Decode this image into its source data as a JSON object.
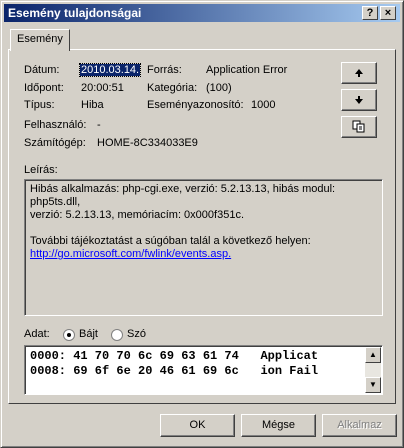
{
  "window": {
    "title": "Esemény tulajdonságai",
    "help_glyph": "?",
    "close_glyph": "×"
  },
  "tab": {
    "label": "Esemény"
  },
  "fields": {
    "date_label": "Dátum:",
    "date_value": "2010.03.14.",
    "time_label": "Időpont:",
    "time_value": "20:00:51",
    "type_label": "Típus:",
    "type_value": "Hiba",
    "user_label": "Felhasználó:",
    "user_value": "-",
    "computer_label": "Számítógép:",
    "computer_value": "HOME-8C334033E9",
    "source_label": "Forrás:",
    "source_value": "Application Error",
    "category_label": "Kategória:",
    "category_value": "(100)",
    "eventid_label": "Eseményazonosító:",
    "eventid_value": "1000"
  },
  "side_buttons": {
    "up": "up-arrow-icon",
    "down": "down-arrow-icon",
    "copy": "copy-icon"
  },
  "description": {
    "label": "Leírás:",
    "line1": "Hibás alkalmazás: php-cgi.exe, verzió: 5.2.13.13, hibás modul: php5ts.dll,",
    "line2": "verzió: 5.2.13.13, memóriacím: 0x000f351c.",
    "line3": "További tájékoztatást a súgóban talál a következő helyen:",
    "link": "http://go.microsoft.com/fwlink/events.asp."
  },
  "data": {
    "label": "Adat:",
    "opt_bytes": "Bájt",
    "opt_words": "Szó",
    "selected": "Bájt",
    "rows": [
      "0000: 41 70 70 6c 69 63 61 74   Applicat",
      "0008: 69 6f 6e 20 46 61 69 6c   ion Fail"
    ]
  },
  "buttons": {
    "ok": "OK",
    "cancel": "Mégse",
    "apply": "Alkalmaz"
  },
  "colors": {
    "titlebar_start": "#0a246a",
    "titlebar_end": "#a6caf0",
    "link": "#0000ff"
  }
}
